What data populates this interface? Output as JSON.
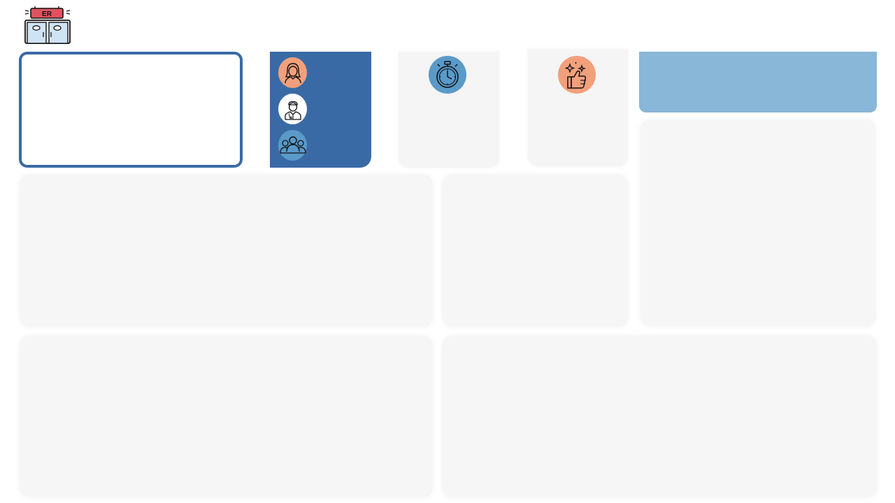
{
  "header": {
    "logo_icon": "emergency-room-door-icon",
    "logo_text": "ER"
  },
  "colors": {
    "primary_blue": "#3a6aa5",
    "light_blue": "#89b7d8",
    "mid_blue": "#5a9ac9",
    "peach": "#f2a07b",
    "card_bg": "#f6f6f6"
  },
  "role_filter": {
    "items": [
      {
        "icon": "female-person-icon"
      },
      {
        "icon": "doctor-icon"
      },
      {
        "icon": "group-icon"
      }
    ]
  },
  "kpis": [
    {
      "icon": "stopwatch-icon"
    },
    {
      "icon": "thumbs-up-sparkle-icon"
    }
  ]
}
